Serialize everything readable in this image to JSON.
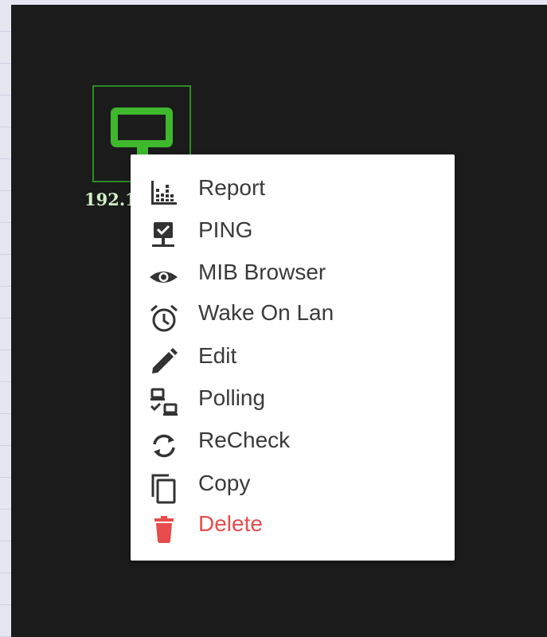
{
  "node": {
    "label": "192.1",
    "icon": "monitor-icon",
    "color": "#3fb82e"
  },
  "menu": {
    "items": [
      {
        "label": "Report",
        "icon": "report-chart-icon"
      },
      {
        "label": "PING",
        "icon": "ping-network-icon"
      },
      {
        "label": "MIB Browser",
        "icon": "eye-icon"
      },
      {
        "label": "Wake On Lan",
        "icon": "alarm-clock-icon"
      },
      {
        "label": "Edit",
        "icon": "pencil-icon"
      },
      {
        "label": "Polling",
        "icon": "polling-devices-icon"
      },
      {
        "label": "ReCheck",
        "icon": "refresh-icon"
      },
      {
        "label": "Copy",
        "icon": "copy-icon"
      },
      {
        "label": "Delete",
        "icon": "trash-icon",
        "color": "#e74c4c"
      }
    ]
  },
  "colors": {
    "canvas": "#1b1b1b",
    "menu_background": "#ffffff",
    "text": "#3a3a3a",
    "danger": "#e74c4c"
  }
}
